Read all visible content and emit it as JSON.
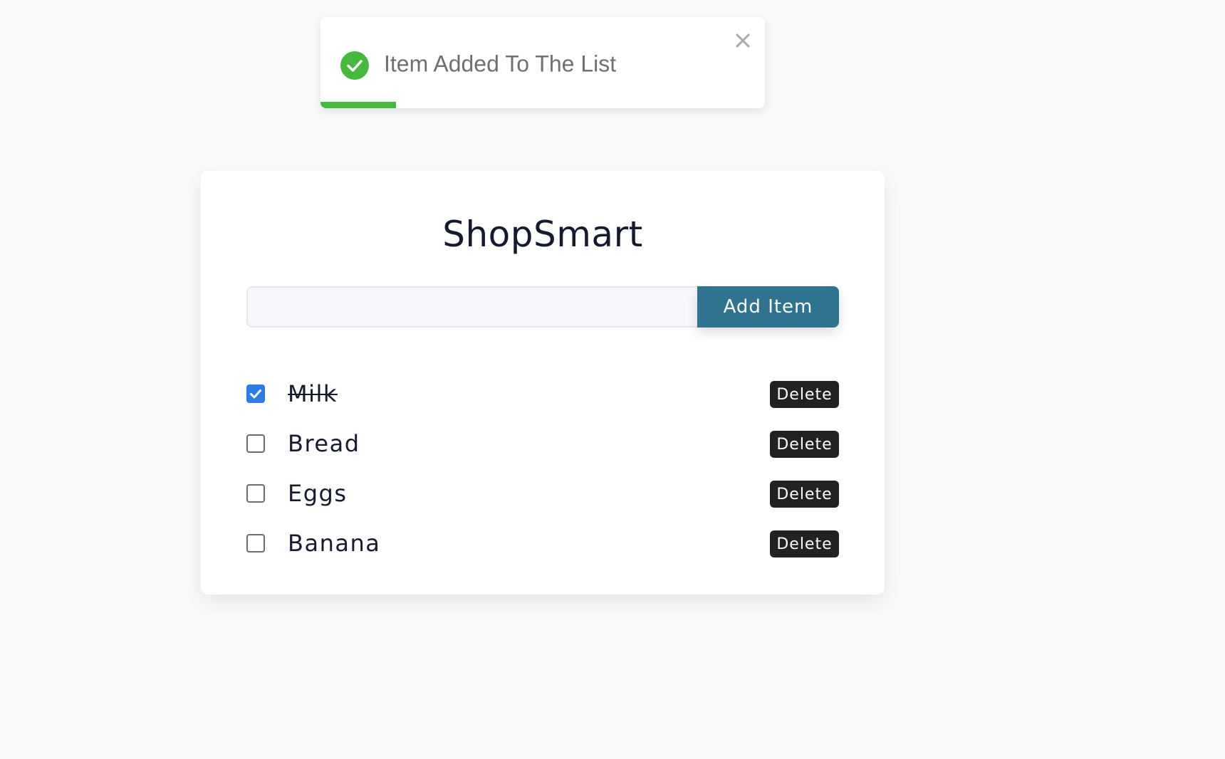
{
  "toast": {
    "message": "Item Added To The List",
    "icon": "check-circle-icon",
    "close_icon": "close-icon",
    "progress": 0.17,
    "accent": "#47b83d"
  },
  "app": {
    "title": "ShopSmart"
  },
  "add_form": {
    "input_value": "",
    "input_placeholder": "",
    "button_label": "Add Item",
    "button_color": "#2f738f"
  },
  "items": [
    {
      "label": "Milk",
      "checked": true,
      "delete_label": "Delete"
    },
    {
      "label": "Bread",
      "checked": false,
      "delete_label": "Delete"
    },
    {
      "label": "Eggs",
      "checked": false,
      "delete_label": "Delete"
    },
    {
      "label": "Banana",
      "checked": false,
      "delete_label": "Delete"
    }
  ]
}
